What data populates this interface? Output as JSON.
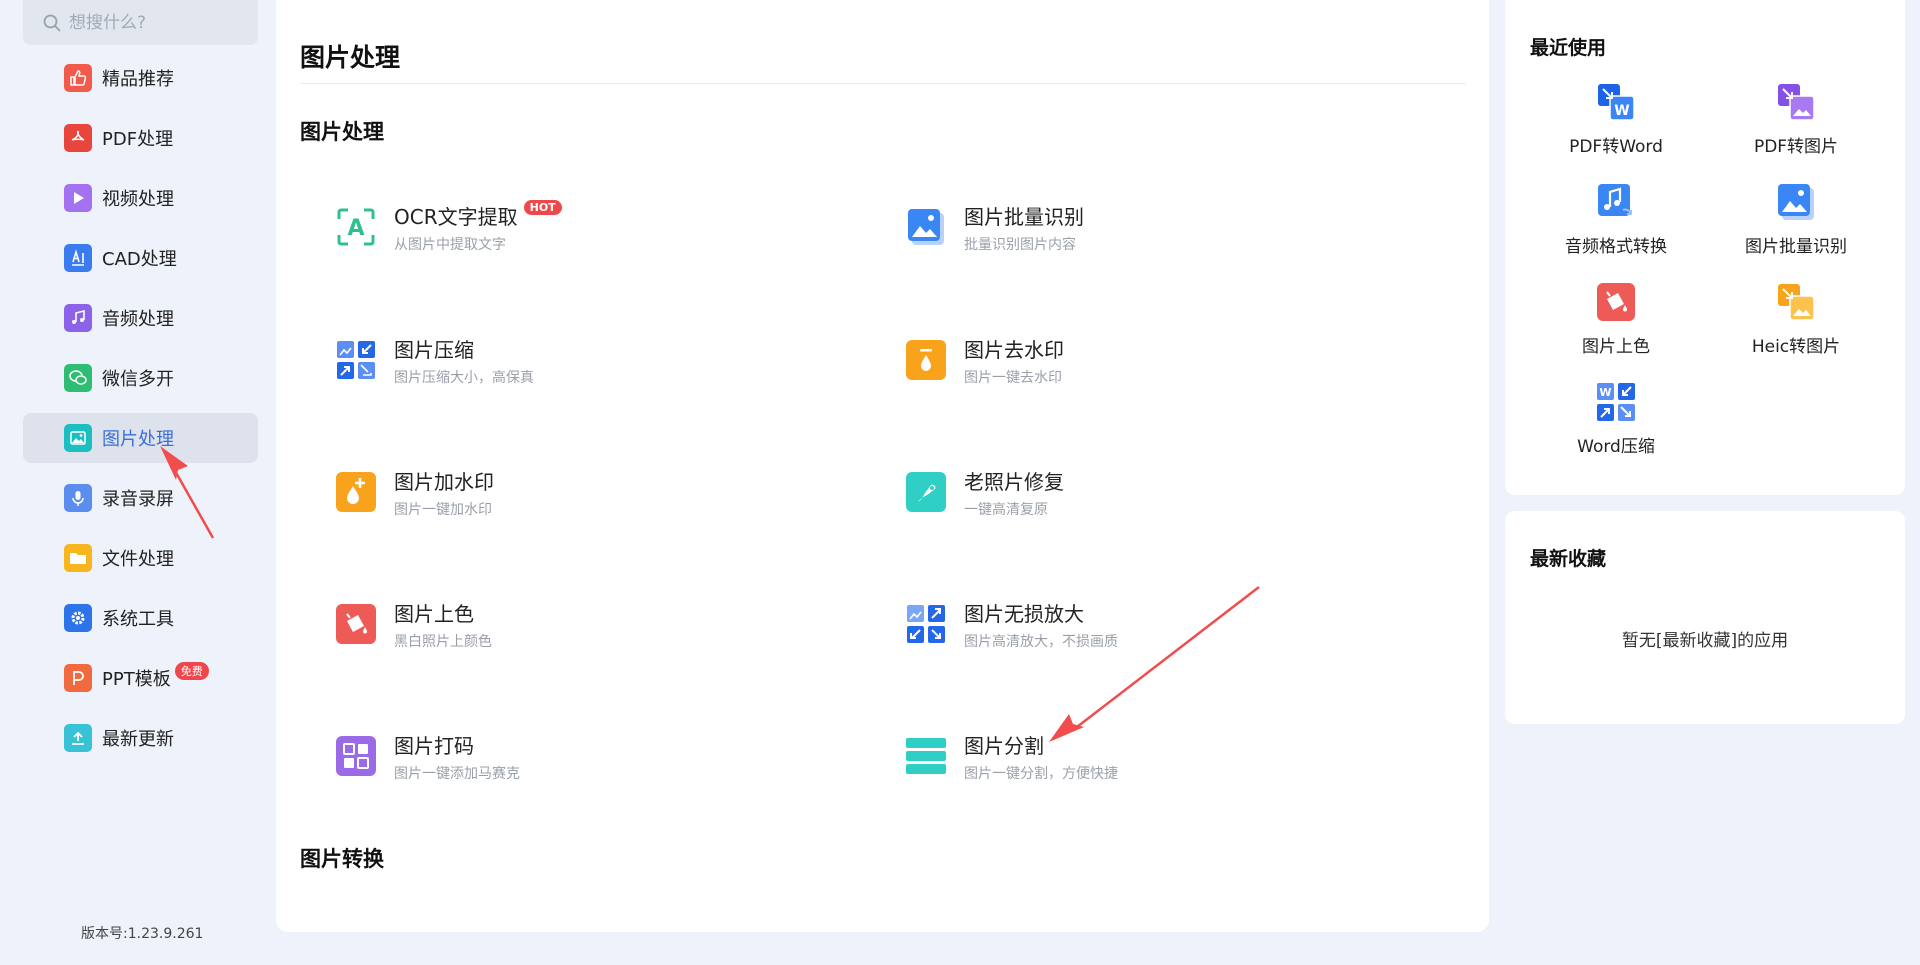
{
  "search": {
    "placeholder": "想搜什么?"
  },
  "sidebar": {
    "items": [
      {
        "label": "精品推荐",
        "icon": "thumbs-up-icon",
        "color": "#f25a4b"
      },
      {
        "label": "PDF处理",
        "icon": "pdf-icon",
        "color": "#e8453c"
      },
      {
        "label": "视频处理",
        "icon": "play-icon",
        "color": "#a472f0"
      },
      {
        "label": "CAD处理",
        "icon": "cad-icon",
        "color": "#3a7bf0"
      },
      {
        "label": "音频处理",
        "icon": "music-note-icon",
        "color": "#8b62e8"
      },
      {
        "label": "微信多开",
        "icon": "wechat-icon",
        "color": "#2fbd73"
      },
      {
        "label": "图片处理",
        "icon": "image-icon",
        "color": "#1bbfbf"
      },
      {
        "label": "录音录屏",
        "icon": "microphone-icon",
        "color": "#5b8def"
      },
      {
        "label": "文件处理",
        "icon": "folder-icon",
        "color": "#f7b51e"
      },
      {
        "label": "系统工具",
        "icon": "gear-icon",
        "color": "#2d74ea"
      },
      {
        "label": "PPT模板",
        "icon": "ppt-icon",
        "color": "#f06a3e",
        "badge": "免费"
      },
      {
        "label": "最新更新",
        "icon": "upload-icon",
        "color": "#38c2d6"
      }
    ],
    "version": "版本号:1.23.9.261"
  },
  "main": {
    "title": "图片处理",
    "section1": "图片处理",
    "section2": "图片转换",
    "tools": [
      {
        "name": "OCR文字提取",
        "desc": "从图片中提取文字",
        "badge": "HOT",
        "icon": "ocr-icon"
      },
      {
        "name": "图片批量识别",
        "desc": "批量识别图片内容",
        "icon": "image-batch-icon"
      },
      {
        "name": "图片压缩",
        "desc": "图片压缩大小，高保真",
        "icon": "compress-icon"
      },
      {
        "name": "图片去水印",
        "desc": "图片一键去水印",
        "icon": "remove-watermark-icon"
      },
      {
        "name": "图片加水印",
        "desc": "图片一键加水印",
        "icon": "add-watermark-icon"
      },
      {
        "name": "老照片修复",
        "desc": "一键高清复原",
        "icon": "photo-repair-icon"
      },
      {
        "name": "图片上色",
        "desc": "黑白照片上颜色",
        "icon": "colorize-icon"
      },
      {
        "name": "图片无损放大",
        "desc": "图片高清放大，不损画质",
        "icon": "enlarge-icon"
      },
      {
        "name": "图片打码",
        "desc": "图片一键添加马赛克",
        "icon": "mosaic-icon"
      },
      {
        "name": "图片分割",
        "desc": "图片一键分割，方便快捷",
        "icon": "split-icon"
      }
    ]
  },
  "recent": {
    "title": "最近使用",
    "items": [
      {
        "label": "PDF转Word",
        "icon": "pdf-to-word-icon"
      },
      {
        "label": "PDF转图片",
        "icon": "pdf-to-image-icon"
      },
      {
        "label": "音频格式转换",
        "icon": "audio-convert-icon"
      },
      {
        "label": "图片批量识别",
        "icon": "image-batch-icon"
      },
      {
        "label": "图片上色",
        "icon": "colorize-icon"
      },
      {
        "label": "Heic转图片",
        "icon": "heic-icon"
      },
      {
        "label": "Word压缩",
        "icon": "word-compress-icon"
      }
    ]
  },
  "favorites": {
    "title": "最新收藏",
    "empty": "暂无[最新收藏]的应用"
  }
}
